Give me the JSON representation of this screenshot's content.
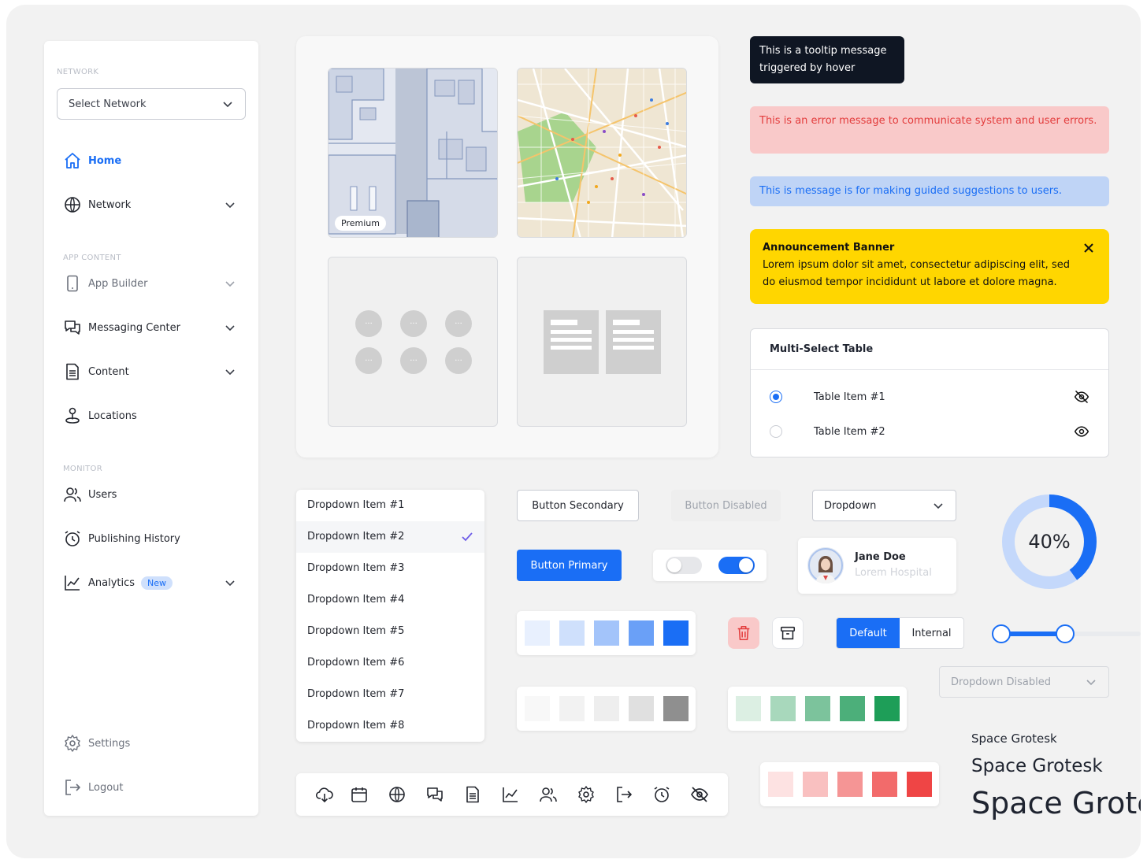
{
  "sidebar": {
    "section_network": "NETWORK",
    "select_network": "Select Network",
    "section_app_content": "APP CONTENT",
    "section_monitor": "MONITOR",
    "items": {
      "home": "Home",
      "network": "Network",
      "app_builder": "App Builder",
      "messaging_center": "Messaging Center",
      "content": "Content",
      "locations": "Locations",
      "users": "Users",
      "publishing_history": "Publishing History",
      "analytics": "Analytics",
      "analytics_badge": "New",
      "settings": "Settings",
      "logout": "Logout"
    }
  },
  "map_panel": {
    "premium_badge": "Premium",
    "dots_glyph": "···"
  },
  "messages": {
    "tooltip": "This is a tooltip message triggered by hover",
    "error": "This is an error message to communicate system and user errors.",
    "info": "This is message is for making guided suggestions to users.",
    "announcement_title": "Announcement Banner",
    "announcement_body": "Lorem ipsum dolor sit amet, consectetur adipiscing elit, sed do eiusmod tempor incididunt ut labore et dolore magna."
  },
  "table": {
    "title": "Multi-Select Table",
    "rows": [
      {
        "label": "Table Item #1",
        "selected": true,
        "icon": "eye-off-icon"
      },
      {
        "label": "Table Item #2",
        "selected": false,
        "icon": "eye-icon"
      }
    ]
  },
  "dropdown_list": {
    "items": [
      "Dropdown Item #1",
      "Dropdown Item #2",
      "Dropdown Item #3",
      "Dropdown Item #4",
      "Dropdown Item #5",
      "Dropdown Item #6",
      "Dropdown Item #7",
      "Dropdown Item #8"
    ],
    "selected_index": 1
  },
  "buttons": {
    "secondary": "Button Secondary",
    "disabled": "Button Disabled",
    "primary": "Button Primary",
    "dropdown": "Dropdown",
    "dropdown_disabled": "Dropdown Disabled"
  },
  "toggles": [
    {
      "state": "off"
    },
    {
      "state": "on"
    }
  ],
  "profile": {
    "name": "Jane Doe",
    "organization": "Lorem Hospital"
  },
  "progress": {
    "value_percent": 40,
    "label": "40%"
  },
  "segmented": {
    "options": [
      "Default",
      "Internal"
    ],
    "selected": "Default"
  },
  "slider": {
    "min_fraction": 0.04,
    "max_fraction": 0.48
  },
  "palettes": {
    "blue": [
      "#e8f0fe",
      "#cfe0fc",
      "#a3c4fa",
      "#6aa0f7",
      "#1a6ef5"
    ],
    "gray": [
      "#f8f8f8",
      "#f2f2f2",
      "#eeeeee",
      "#e0e0e0",
      "#8f8f8f"
    ],
    "green": [
      "#dcefe3",
      "#a8d8bc",
      "#7cc39c",
      "#4caf7a",
      "#1e9e58"
    ],
    "red": [
      "#fde2e2",
      "#f9c0c0",
      "#f59595",
      "#f26b6b",
      "#ef4545"
    ]
  },
  "colors": {
    "accent": "#1a6ef5",
    "error_bg": "#f9c9c9",
    "error_text": "#e33d3d",
    "info_bg": "#bfd4f6",
    "announcement_bg": "#ffd600",
    "tooltip_bg": "#0f1623"
  },
  "icon_bar": [
    "cloud-download-icon",
    "calendar-icon",
    "globe-icon",
    "chat-icon",
    "document-icon",
    "chart-icon",
    "users-icon",
    "gear-icon",
    "logout-icon",
    "alarm-icon",
    "eye-off-icon"
  ],
  "typography": {
    "sample_small": "Space Grotesk",
    "sample_medium": "Space Grotesk",
    "sample_large": "Space Grotesk"
  }
}
